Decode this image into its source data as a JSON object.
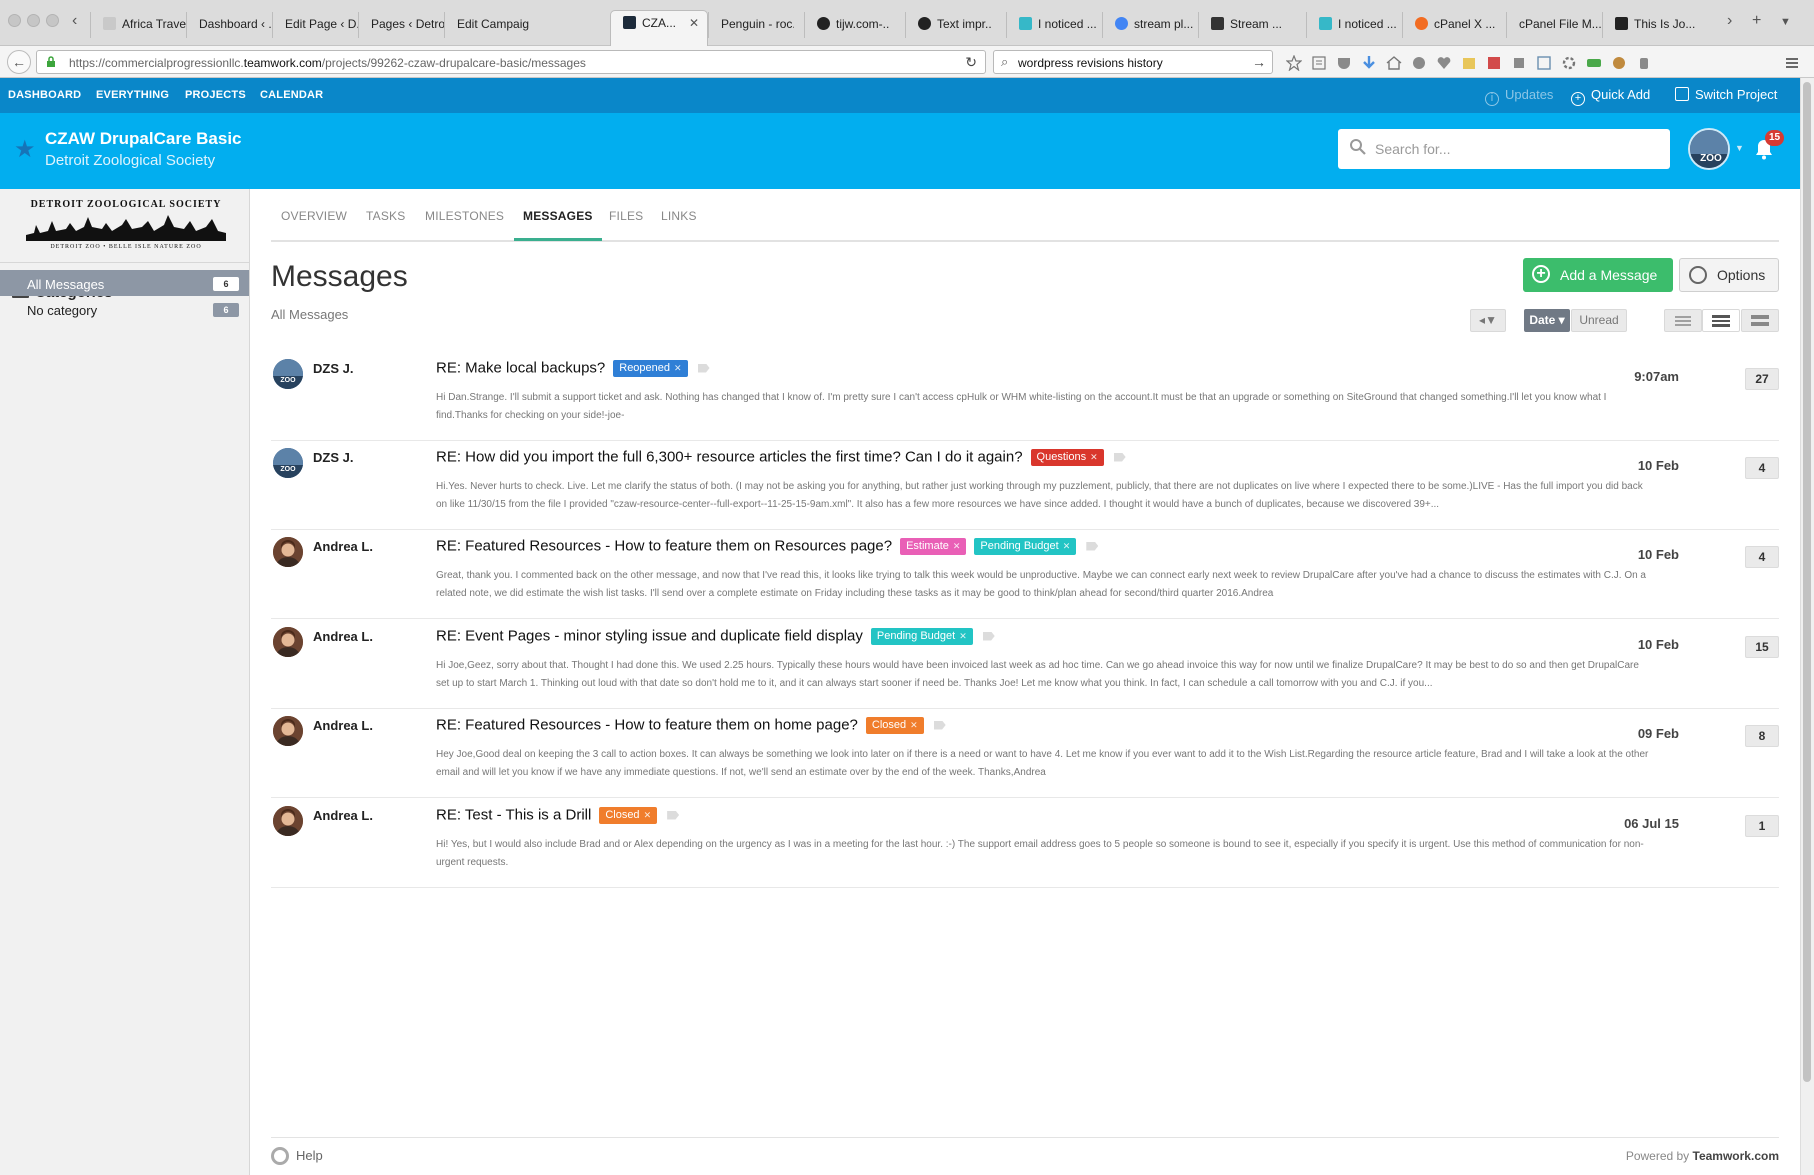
{
  "browser": {
    "tabs": [
      {
        "label": "Africa Travel ...",
        "active": false
      },
      {
        "label": "Dashboard ‹ ...",
        "active": false
      },
      {
        "label": "Edit Page ‹ D...",
        "active": false
      },
      {
        "label": "Pages ‹ Detroi...",
        "active": false
      },
      {
        "label": "Edit Campaig...",
        "active": false
      },
      {
        "label": "CZA...",
        "active": true
      },
      {
        "label": "Penguin - roc...",
        "active": false
      },
      {
        "label": "tijw.com-...",
        "active": false
      },
      {
        "label": "Text impr...",
        "active": false
      },
      {
        "label": "I noticed ...",
        "active": false
      },
      {
        "label": "stream pl...",
        "active": false
      },
      {
        "label": "Stream ...",
        "active": false
      },
      {
        "label": "I noticed ...",
        "active": false
      },
      {
        "label": "cPanel X ...",
        "active": false
      },
      {
        "label": "cPanel File M...",
        "active": false
      },
      {
        "label": "This Is Jo...",
        "active": false
      }
    ],
    "url_prefix": "https://commercialprogressionllc.",
    "url_host": "teamwork.com",
    "url_path": "/projects/99262-czaw-drupalcare-basic/messages",
    "search_query": "wordpress revisions history"
  },
  "topnav": {
    "items": [
      "DASHBOARD",
      "EVERYTHING",
      "PROJECTS",
      "CALENDAR"
    ],
    "updates": "Updates",
    "quick_add": "Quick Add",
    "switch_project": "Switch Project"
  },
  "project": {
    "title": "CZAW DrupalCare Basic",
    "company": "Detroit Zoological Society",
    "search_placeholder": "Search for...",
    "notification_count": "15"
  },
  "sidebar": {
    "logo_top": "DETROIT ZOOLOGICAL SOCIETY",
    "logo_bottom": "DETROIT ZOO • BELLE ISLE NATURE ZOO",
    "categories_heading": "Categories",
    "categories": [
      {
        "label": "All Messages",
        "count": "6",
        "selected": true
      },
      {
        "label": "No category",
        "count": "6",
        "selected": false
      }
    ]
  },
  "tabs": [
    "OVERVIEW",
    "TASKS",
    "MILESTONES",
    "MESSAGES",
    "FILES",
    "LINKS"
  ],
  "page": {
    "title": "Messages",
    "subtitle": "All Messages",
    "add_button": "Add a Message",
    "options_button": "Options",
    "sort_date": "Date",
    "sort_unread": "Unread"
  },
  "messages": [
    {
      "author": "DZS J.",
      "avatar": "dzs",
      "subject": "RE: Make local backups?",
      "tags": [
        {
          "label": "Reopened",
          "color": "#2f7fd6"
        }
      ],
      "preview": "Hi Dan.Strange. I'll submit a support ticket and ask. Nothing has changed that I know of. I'm pretty sure I can't access cpHulk or WHM white-listing on the account.It must be that an upgrade or something on SiteGround that changed something.I'll let you know what I find.Thanks for checking on your side!-joe-",
      "date": "9:07am",
      "count": "27"
    },
    {
      "author": "DZS J.",
      "avatar": "dzs",
      "subject": "RE: How did you import the full 6,300+ resource articles the first time? Can I do it again?",
      "tags": [
        {
          "label": "Questions",
          "color": "#d9362c"
        }
      ],
      "preview": "Hi.Yes. Never hurts to check. Live. Let me clarify the status of both. (I may not be asking you for anything, but rather just working through my puzzlement, publicly, that there are not duplicates on live where I expected there to be some.)LIVE - Has the full import you did back on like 11/30/15 from the file I provided \"czaw-resource-center--full-export--11-25-15-9am.xml\". It also has a few more resources we have since added. I thought it would have a bunch of duplicates, because we discovered 39+...",
      "date": "10 Feb",
      "count": "4"
    },
    {
      "author": "Andrea L.",
      "avatar": "andrea",
      "subject": "RE: Featured Resources - How to feature them on Resources page?",
      "tags": [
        {
          "label": "Estimate",
          "color": "#e95fb6"
        },
        {
          "label": "Pending Budget",
          "color": "#22c4c4"
        }
      ],
      "preview": "Great, thank you. I commented back on the other message, and now that I've read this, it looks like trying to talk this week would be unproductive. Maybe we can connect early next week to review DrupalCare after you've had a chance to discuss the estimates with C.J. On a related note, we did estimate the wish list tasks. I'll send over a complete estimate on Friday including these tasks as it may be good to think/plan ahead for second/third quarter 2016.Andrea",
      "date": "10 Feb",
      "count": "4"
    },
    {
      "author": "Andrea L.",
      "avatar": "andrea",
      "subject": "RE: Event Pages - minor styling issue and duplicate field display",
      "tags": [
        {
          "label": "Pending Budget",
          "color": "#22c4c4"
        }
      ],
      "preview": "Hi Joe,Geez, sorry about that. Thought I had done this. We used 2.25 hours. Typically these hours would have been invoiced last week as ad hoc time. Can we go ahead invoice this way for now until we finalize DrupalCare? It may be best to do so and then get DrupalCare set up to start March 1. Thinking out loud with that date so don't hold me to it, and it can always start sooner if need be. Thanks Joe! Let me know what you think. In fact, I can schedule a call tomorrow with you and C.J. if you...",
      "date": "10 Feb",
      "count": "15"
    },
    {
      "author": "Andrea L.",
      "avatar": "andrea",
      "subject": "RE: Featured Resources - How to feature them on home page?",
      "tags": [
        {
          "label": "Closed",
          "color": "#f07d2c"
        }
      ],
      "preview": "Hey Joe,Good deal on keeping the 3 call to action boxes. It can always be something we look into later on if there is a need or want to have 4. Let me know if you ever want to add it to the Wish List.Regarding the resource article feature, Brad and I will take a look at the other email and will let you know if we have any immediate questions. If not, we'll send an estimate over by the end of the week. Thanks,Andrea",
      "date": "09 Feb",
      "count": "8"
    },
    {
      "author": "Andrea L.",
      "avatar": "andrea",
      "subject": "RE: Test - This is a Drill",
      "tags": [
        {
          "label": "Closed",
          "color": "#f07d2c"
        }
      ],
      "preview": "Hi! Yes, but I would also include Brad and or Alex depending on the urgency as I was in a meeting for the last hour. :-) The support email address goes to 5 people so someone is bound to see it, especially if you specify it is urgent. Use this method of communication for non-urgent requests.",
      "date": "06 Jul 15",
      "count": "1"
    }
  ],
  "footer": {
    "help": "Help",
    "powered_prefix": "Powered by ",
    "powered_brand": "Teamwork.com"
  }
}
